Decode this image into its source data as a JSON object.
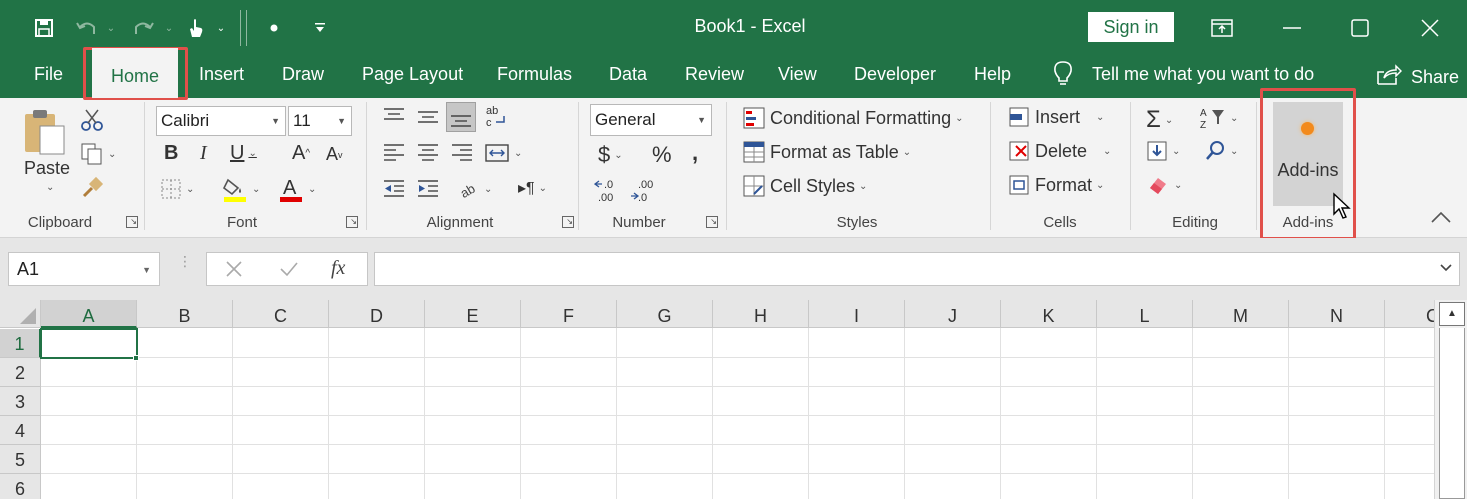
{
  "titlebar": {
    "doc_title": "Book1  -  Excel",
    "signin_label": "Sign in",
    "icons": [
      "save-icon",
      "undo-icon",
      "redo-icon",
      "touch-mode-icon",
      "customize-qat-icon",
      "ribbon-display-icon",
      "minimize-icon",
      "maximize-icon",
      "close-icon"
    ]
  },
  "tabs": {
    "file": "File",
    "home": "Home",
    "insert": "Insert",
    "draw": "Draw",
    "page_layout": "Page Layout",
    "formulas": "Formulas",
    "data": "Data",
    "review": "Review",
    "view": "View",
    "developer": "Developer",
    "help": "Help",
    "tell_me": "Tell me what you want to do",
    "share": "Share"
  },
  "ribbon": {
    "clipboard": {
      "label": "Clipboard",
      "paste": "Paste"
    },
    "font": {
      "label": "Font",
      "font_name": "Calibri",
      "font_size": "11"
    },
    "alignment": {
      "label": "Alignment"
    },
    "number": {
      "label": "Number",
      "format": "General",
      "currency": "$",
      "percent": "%",
      "comma": ")"
    },
    "styles": {
      "label": "Styles",
      "conditional_formatting": "Conditional Formatting",
      "format_as_table": "Format as Table",
      "cell_styles": "Cell Styles"
    },
    "cells": {
      "label": "Cells",
      "insert": "Insert",
      "delete": "Delete",
      "format": "Format"
    },
    "editing": {
      "label": "Editing"
    },
    "addins": {
      "label": "Add-ins",
      "button": "Add-ins"
    },
    "accent_highlight": "#e0504a",
    "brand": "#217346"
  },
  "formula_bar": {
    "name_box": "A1",
    "fx": "fx",
    "formula": ""
  },
  "grid": {
    "columns": [
      "A",
      "B",
      "C",
      "D",
      "E",
      "F",
      "G",
      "H",
      "I",
      "J",
      "K",
      "L",
      "M",
      "N",
      "C"
    ],
    "rows": [
      "1",
      "2",
      "3",
      "4",
      "5",
      "6"
    ],
    "active_cell": "A1"
  }
}
